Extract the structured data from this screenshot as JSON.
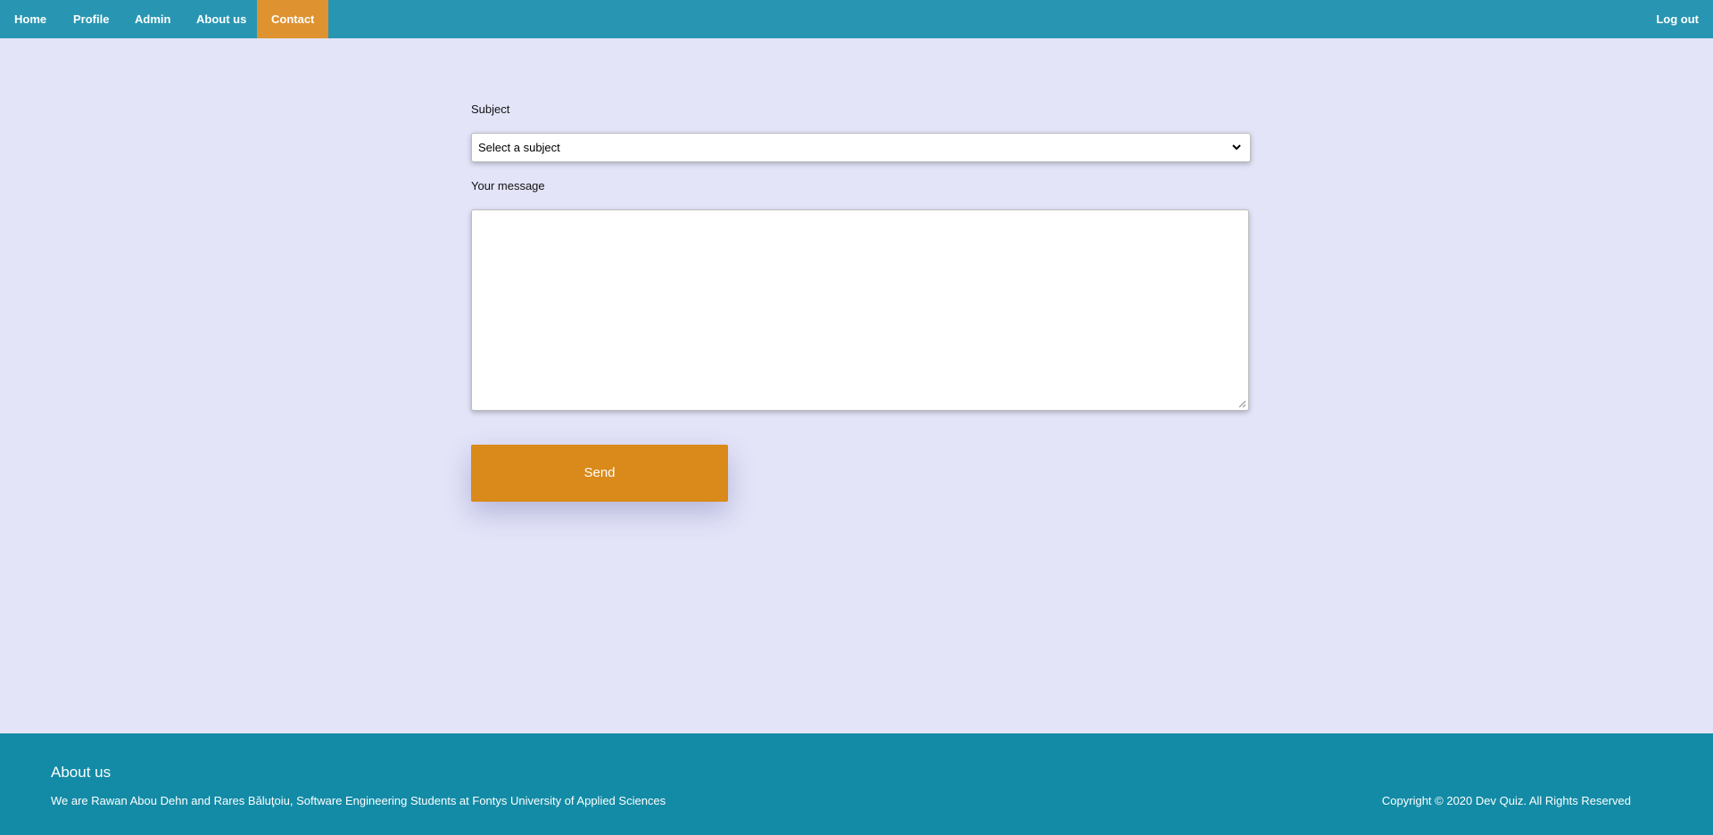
{
  "nav": {
    "items": [
      {
        "label": "Home"
      },
      {
        "label": "Profile"
      },
      {
        "label": "Admin"
      },
      {
        "label": "About us"
      },
      {
        "label": "Contact",
        "active": true
      }
    ],
    "logout_label": "Log out"
  },
  "form": {
    "subject_label": "Subject",
    "subject_selected": "Select a subject",
    "message_label": "Your message",
    "message_value": "",
    "send_label": "Send"
  },
  "footer": {
    "title": "About us",
    "description": "We are Rawan Abou Dehn and Rares Băluţoiu, Software Engineering Students at Fontys University of Applied Sciences",
    "copyright": "Copyright © 2020 Dev Quiz. All Rights Reserved"
  },
  "colors": {
    "nav_bg": "#2896b2",
    "nav_active": "#de9230",
    "page_bg": "#e3e4f8",
    "button_bg": "#d98a1a",
    "footer_bg": "#138ba6"
  },
  "icons": {
    "select_chevron": "chevron-down-icon",
    "textarea_resize": "resize-handle-icon"
  }
}
